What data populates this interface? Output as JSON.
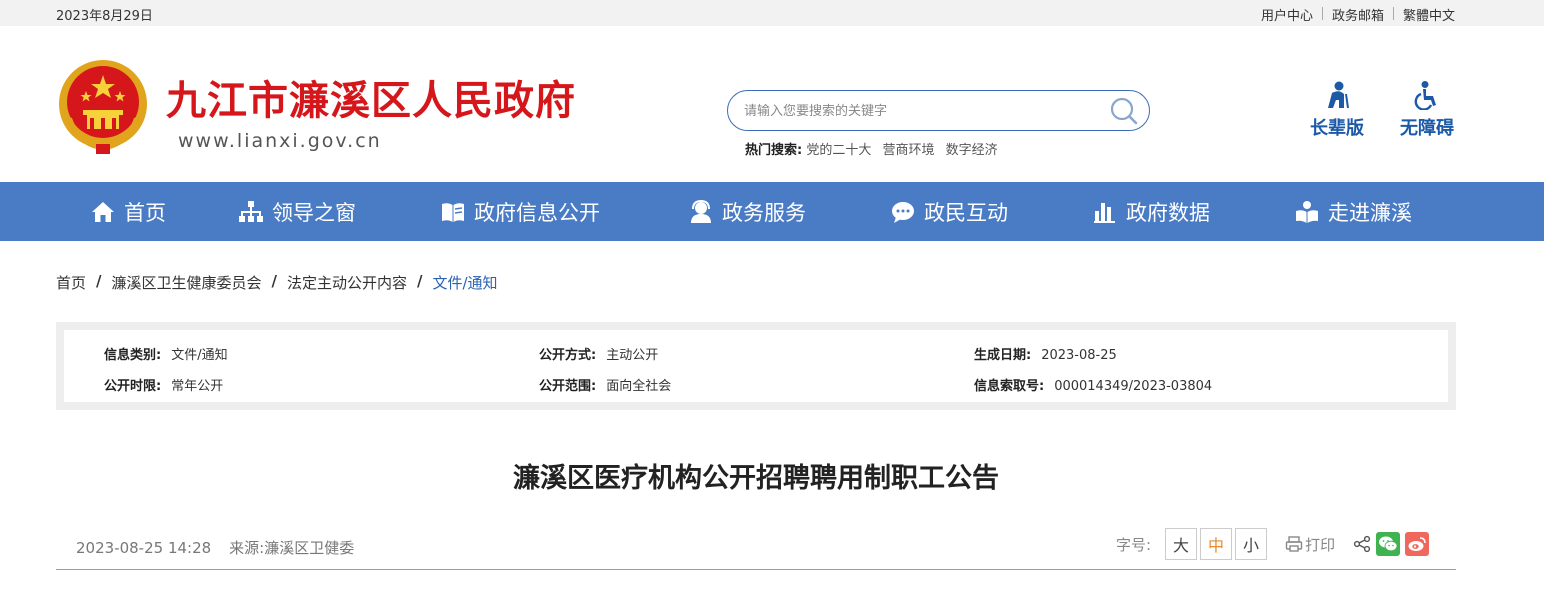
{
  "topbar": {
    "date": "2023年8月29日",
    "links": [
      "用户中心",
      "政务邮箱",
      "繁體中文"
    ]
  },
  "header": {
    "site_title": "九江市濂溪区人民政府",
    "site_url": "www.lianxi.gov.cn",
    "search_placeholder": "请输入您要搜索的关键字",
    "hot_label": "热门搜索:",
    "hot_items": [
      "党的二十大",
      "营商环境",
      "数字经济"
    ],
    "modes": {
      "elder": "长辈版",
      "access": "无障碍"
    }
  },
  "nav": {
    "items": [
      "首页",
      "领导之窗",
      "政府信息公开",
      "政务服务",
      "政民互动",
      "政府数据",
      "走进濂溪"
    ]
  },
  "breadcrumb": [
    "首页",
    "濂溪区卫生健康委员会",
    "法定主动公开内容",
    "文件/通知"
  ],
  "info": {
    "category_label": "信息类别:",
    "category": "文件/通知",
    "method_label": "公开方式:",
    "method": "主动公开",
    "date_label": "生成日期:",
    "date": "2023-08-25",
    "period_label": "公开时限:",
    "period": "常年公开",
    "scope_label": "公开范围:",
    "scope": "面向全社会",
    "index_label": "信息索取号:",
    "index": "000014349/2023-03804"
  },
  "article": {
    "title": "濂溪区医疗机构公开招聘聘用制职工公告",
    "datetime": "2023-08-25 14:28",
    "source": "来源:濂溪区卫健委",
    "font_label": "字号:",
    "font_sizes": [
      "大",
      "中",
      "小"
    ],
    "print_label": "打印"
  },
  "colors": {
    "brand_red": "#d5171b",
    "nav_blue": "#4a7cc6",
    "link_blue": "#2c62b4"
  }
}
